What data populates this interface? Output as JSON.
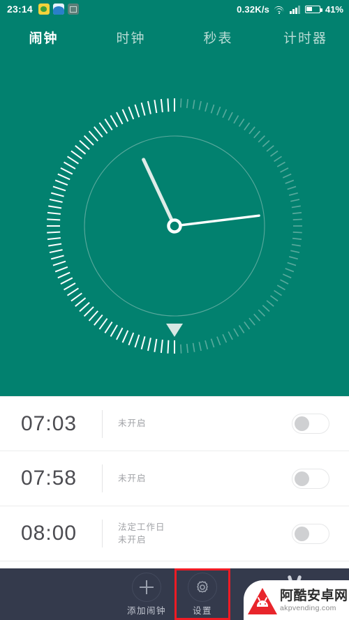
{
  "status_bar": {
    "time": "23:14",
    "net_speed": "0.32K/s",
    "battery_percent": "41%",
    "icons": [
      "wechat-icon",
      "browser-icon",
      "app-icon",
      "wifi-icon",
      "signal-icon",
      "battery-icon"
    ]
  },
  "tabs": [
    {
      "label": "闹钟",
      "name": "tab-alarm",
      "active": true
    },
    {
      "label": "时钟",
      "name": "tab-clock",
      "active": false
    },
    {
      "label": "秒表",
      "name": "tab-stopwatch",
      "active": false
    },
    {
      "label": "计时器",
      "name": "tab-timer",
      "active": false
    }
  ],
  "clock": {
    "hour_angle_deg": -25,
    "minute_angle_deg": 83,
    "marker_angle_deg": 180,
    "tick_count": 120,
    "progress_ticks": 60,
    "face_color": "#02816f",
    "hand_color": "#f2f7f5"
  },
  "alarms": [
    {
      "time": "07:03",
      "label": "",
      "state": "未开启",
      "enabled": false
    },
    {
      "time": "07:58",
      "label": "",
      "state": "未开启",
      "enabled": false
    },
    {
      "time": "08:00",
      "label": "法定工作日",
      "state": "未开启",
      "enabled": false
    }
  ],
  "bottom_bar": {
    "items": [
      {
        "label": "添加闹钟",
        "name": "add-alarm-button",
        "icon": "plus-icon",
        "highlighted": false
      },
      {
        "label": "设置",
        "name": "settings-button",
        "icon": "gear-icon",
        "highlighted": true
      }
    ],
    "highlight_color": "#ef1b24",
    "background": "#343a4c"
  },
  "watermark": {
    "site_cn": "阿酷安卓网",
    "site_en": "akpvending.com"
  }
}
